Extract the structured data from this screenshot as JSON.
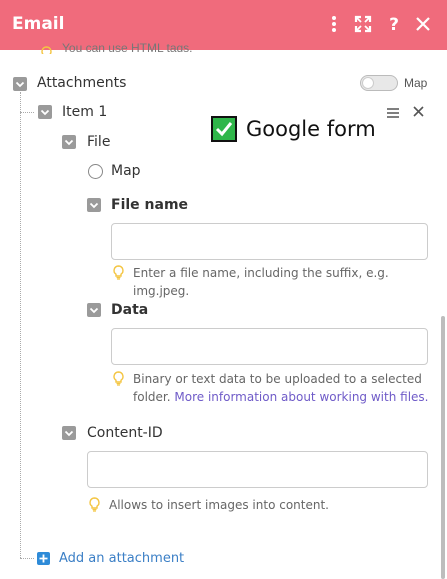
{
  "header": {
    "title": "Email",
    "icons": [
      "more-vertical-icon",
      "expand-icon",
      "help-icon",
      "close-icon"
    ],
    "bg_color": "#f06b7c"
  },
  "cutoff_text": "You can use HTML tags.",
  "attachments": {
    "label": "Attachments",
    "map_toggle_label": "Map",
    "map_toggle_on": false
  },
  "item": {
    "label": "Item 1"
  },
  "annotation": {
    "label": "Google form",
    "icon": "check-mark-icon",
    "color": "#2fb64a"
  },
  "file": {
    "label": "File",
    "map_label": "Map",
    "file_name": {
      "label": "File name",
      "value": "",
      "hint": "Enter a file name, including the suffix, e.g. img.jpeg."
    },
    "data": {
      "label": "Data",
      "value": "",
      "hint_line1": "Binary or text data to be uploaded to a selected",
      "hint_line2_prefix": "folder.",
      "hint_link": "More information about working with files."
    }
  },
  "content_id": {
    "label": "Content-ID",
    "value": "",
    "hint": "Allows to insert images into content."
  },
  "add_attachment_label": "Add an attachment",
  "colors": {
    "link": "#6f5bc8",
    "add_link": "#3b7fc6",
    "bulb": "#f4c542"
  }
}
